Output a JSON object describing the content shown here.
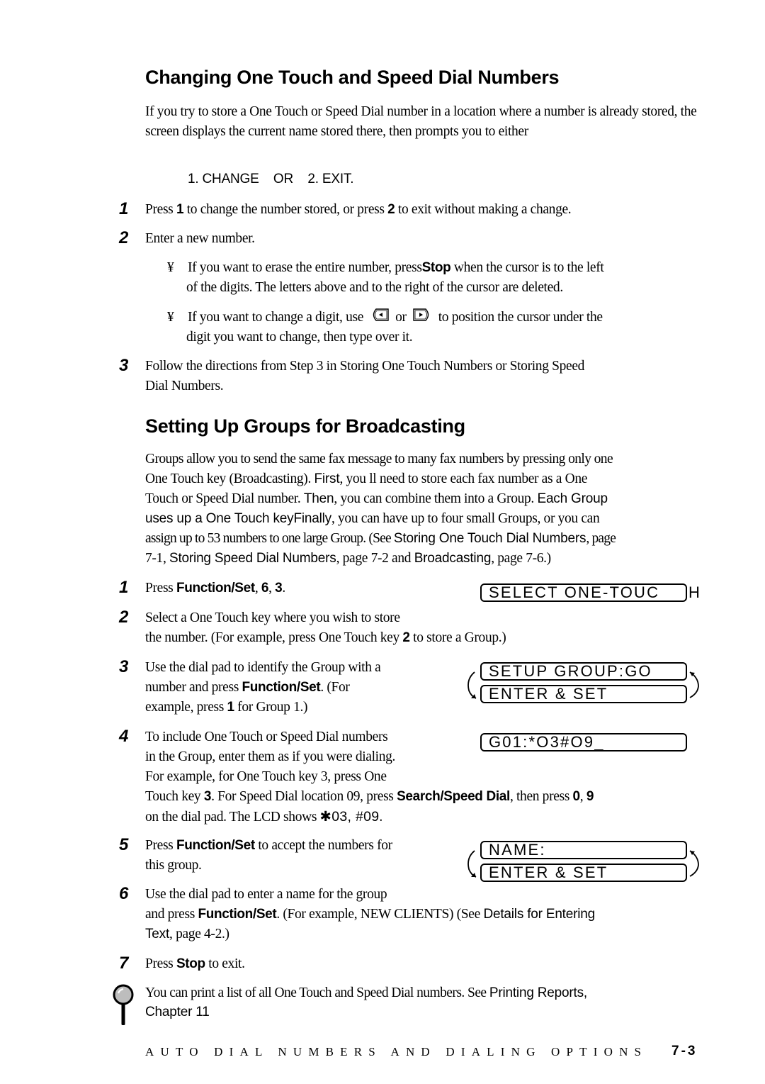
{
  "section1": {
    "title": "Changing One Touch and Speed Dial Numbers",
    "intro": "If you try to store a One Touch or Speed Dial number in a location where a number is already stored, the screen displays the current name stored there, then prompts you to either",
    "lcd_prompt": "1. CHANGE    OR    2. EXIT.",
    "steps": [
      {
        "num": "1",
        "parts": [
          "Press ",
          "1",
          " to change the number stored, or press ",
          "2",
          " to exit without making a change."
        ]
      },
      {
        "num": "2",
        "text": "Enter a new number."
      },
      {
        "num": "3",
        "line1": "Follow the directions from Step 3 in Storing One Touch Numbers or Storing Speed",
        "line2": "Dial Numbers."
      }
    ],
    "bullets": [
      {
        "symbol": "¥",
        "pre": "If you want to erase the entire number, press",
        "key": "Stop",
        "post": " when the cursor is to the left",
        "line2": "of the digits. The letters above and to the right of the cursor are deleted."
      },
      {
        "symbol": "¥",
        "pre": "If you want to change a digit, use",
        "left_icon": "left-arrow-key-icon",
        "mid": "or",
        "right_icon": "right-arrow-key-icon",
        "post": "to position the cursor under the",
        "line2": "digit you want to change, then type over it."
      }
    ]
  },
  "section2": {
    "title": "Setting Up Groups for Broadcasting",
    "intro": {
      "l1": "Groups allow you to send the same fax message to many fax numbers by pressing only one",
      "l2a": "One Touch key (Broadcasting).  ",
      "l2b": "First",
      "l2c": ", you ll need to store each fax number as a One",
      "l3a": "Touch or Speed Dial number.  ",
      "l3b": "Then",
      "l3c": ", you can combine them into a Group.  ",
      "l3d": "Each Group",
      "l4a": "uses up a One Touch key",
      "l4b": "Finally",
      "l4c": ", you can have up to four small Groups, or you can",
      "l5a": "assign up to 53 numbers to one large Group. (See ",
      "l5b": "Storing One Touch Dial Numbers",
      "l5c": ", page",
      "l6a": "7-1, ",
      "l6b": "Storing Speed Dial Numbers",
      "l6c": ", page 7-2 and ",
      "l6d": "Broadcasting",
      "l6e": ", page 7-6.)"
    },
    "steps": {
      "s1": {
        "num": "1",
        "a": "Press ",
        "b": "Function/Set",
        "c": ", ",
        "d": "6",
        "e": ", ",
        "f": "3",
        "g": "."
      },
      "s2": {
        "num": "2",
        "l1": "Select a One Touch key where you wish to store",
        "l2a": "the number.  (For example, press One Touch key ",
        "l2b": "2",
        "l2c": " to store a Group.)"
      },
      "s3": {
        "num": "3",
        "l1": "Use the dial pad to identify the Group with a",
        "l2a": "number and press ",
        "l2b": "Function/Set",
        "l2c": ". (For",
        "l3a": "example, press ",
        "l3b": "1",
        "l3c": " for Group 1.)"
      },
      "s4": {
        "num": "4",
        "l1": "To include One Touch or Speed Dial numbers",
        "l2": "in the Group, enter them as if you were dialing.",
        "l3": "For example, for One Touch key 3, press One",
        "l4a": "Touch key ",
        "l4b": "3",
        "l4c": ". For Speed Dial location 09, press ",
        "l4d": "Search/Speed Dial",
        "l4e": ", then press ",
        "l4f": "0",
        "l4g": ", ",
        "l4h": "9",
        "l5a": "on the dial pad. The LCD shows ",
        "l5b": "✱03, #09",
        "l5c": "."
      },
      "s5": {
        "num": "5",
        "l1a": "Press ",
        "l1b": "Function/Set",
        "l1c": " to accept the numbers for",
        "l2": "this group."
      },
      "s6": {
        "num": "6",
        "l1": "Use the dial pad to enter a name for the group",
        "l2a": "and press ",
        "l2b": "Function/Set",
        "l2c": ". (For example, NEW CLIENTS) (See ",
        "l2d": "Details for Entering",
        "l3a": "Text",
        "l3b": ", page 4-2.)"
      },
      "s7": {
        "num": "7",
        "a": "Press ",
        "b": "Stop",
        "c": " to exit."
      }
    },
    "lcd": {
      "select_one_touch": "SELECT ONE-TOUC",
      "select_one_touch_overflow": "H",
      "setup_group": "SETUP GROUP:GO",
      "enter_set_1": "ENTER & SET",
      "group_entry": "G01:*O3#O9",
      "cursor": "_",
      "name": "NAME:",
      "enter_set_2": "ENTER & SET"
    },
    "note": {
      "icon": "magnifier-icon",
      "a": "You can print a list of all One Touch and Speed Dial numbers.  See ",
      "b": "Printing Reports,",
      "c": "Chapter 11"
    }
  },
  "footer": {
    "chapter_title": "AUTO DIAL NUMBERS AND DIALING OPTIONS",
    "page_number": "7-3"
  }
}
